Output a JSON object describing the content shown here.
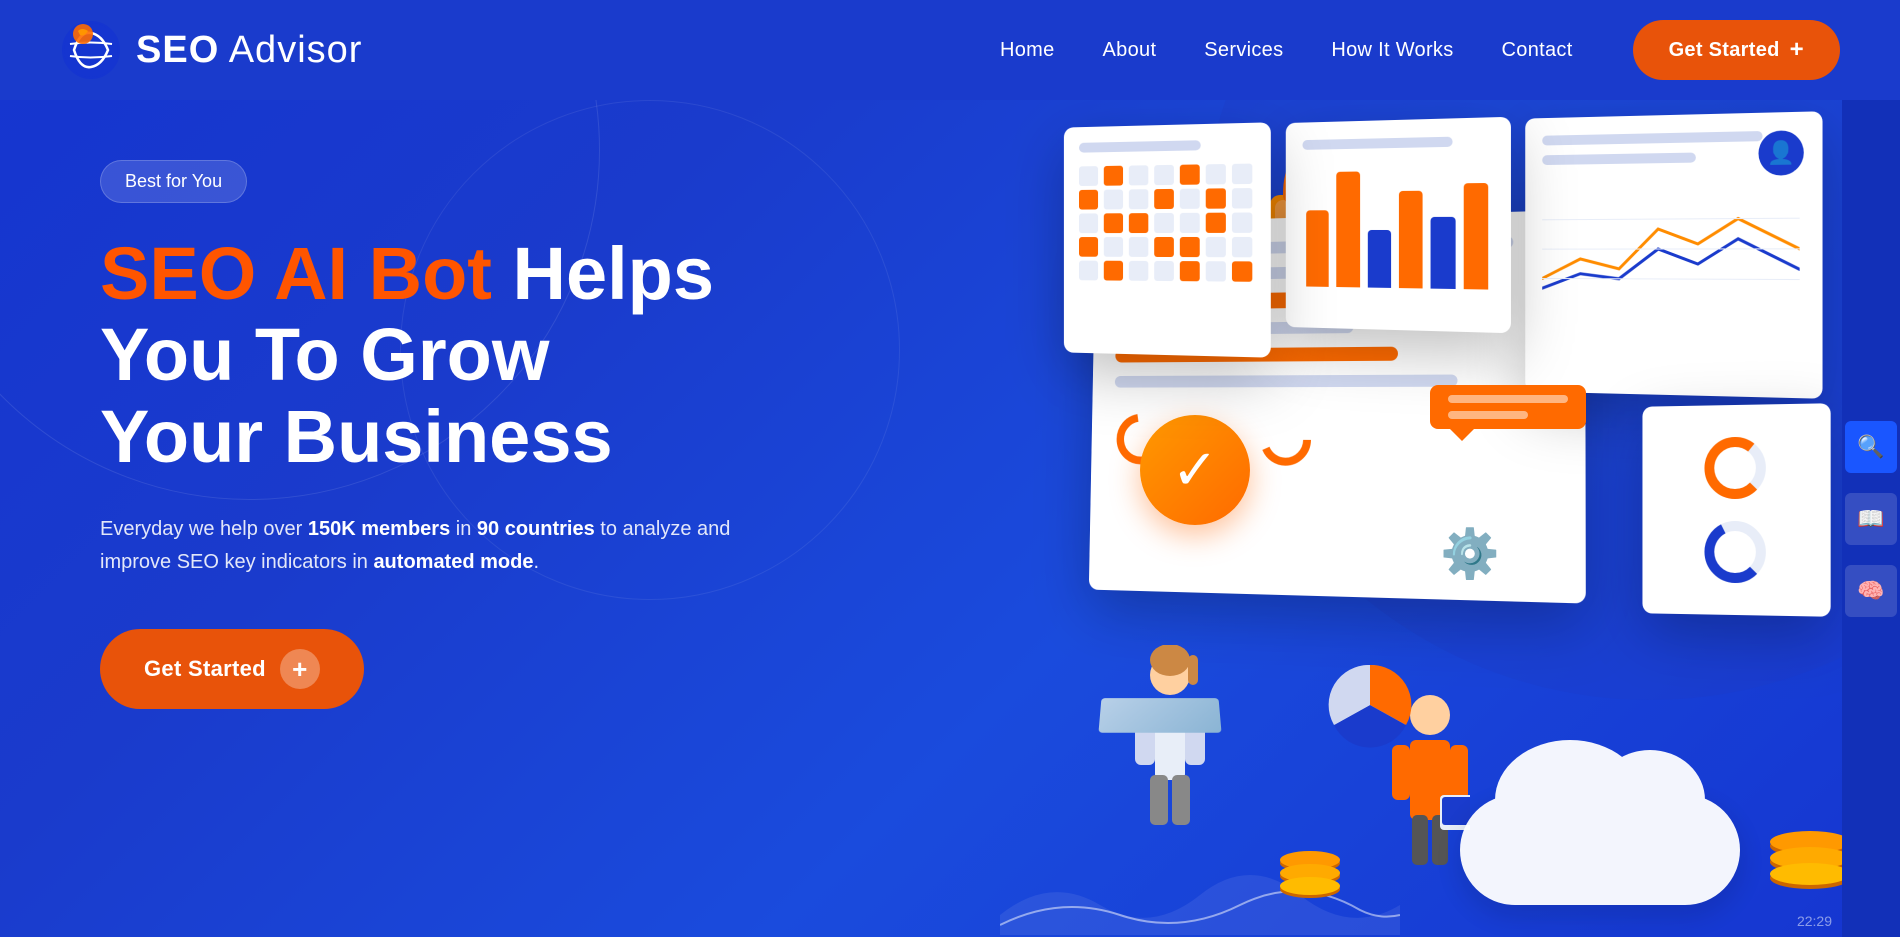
{
  "brand": {
    "name_bold": "SEO",
    "name_light": " Advisor",
    "logo_icon": "globe"
  },
  "navbar": {
    "links": [
      {
        "label": "Home",
        "id": "home"
      },
      {
        "label": "About",
        "id": "about"
      },
      {
        "label": "Services",
        "id": "services"
      },
      {
        "label": "How It Works",
        "id": "how-it-works"
      },
      {
        "label": "Contact",
        "id": "contact"
      }
    ],
    "cta_label": "Get Started",
    "cta_plus": "+"
  },
  "hero": {
    "badge": "Best for You",
    "headline_orange": "SEO AI Bot",
    "headline_white": " Helps You To Grow Your Business",
    "subtext_plain1": "Everyday we help over ",
    "subtext_bold1": "150K members",
    "subtext_plain2": " in ",
    "subtext_bold2": "90 countries",
    "subtext_plain3": " to analyze and improve SEO key indicators in ",
    "subtext_bold3": "automated mode",
    "subtext_end": ".",
    "cta_label": "Get Started",
    "cta_plus": "+"
  },
  "side_buttons": [
    {
      "icon": "🔍",
      "label": "search-icon"
    },
    {
      "icon": "📖",
      "label": "book-icon"
    },
    {
      "icon": "🧠",
      "label": "brain-icon"
    }
  ],
  "timestamp": "22:29",
  "colors": {
    "bg_blue": "#1535d0",
    "nav_blue": "#1a3bcc",
    "orange": "#e8530a",
    "orange_light": "#ff8c00",
    "white": "#ffffff"
  }
}
